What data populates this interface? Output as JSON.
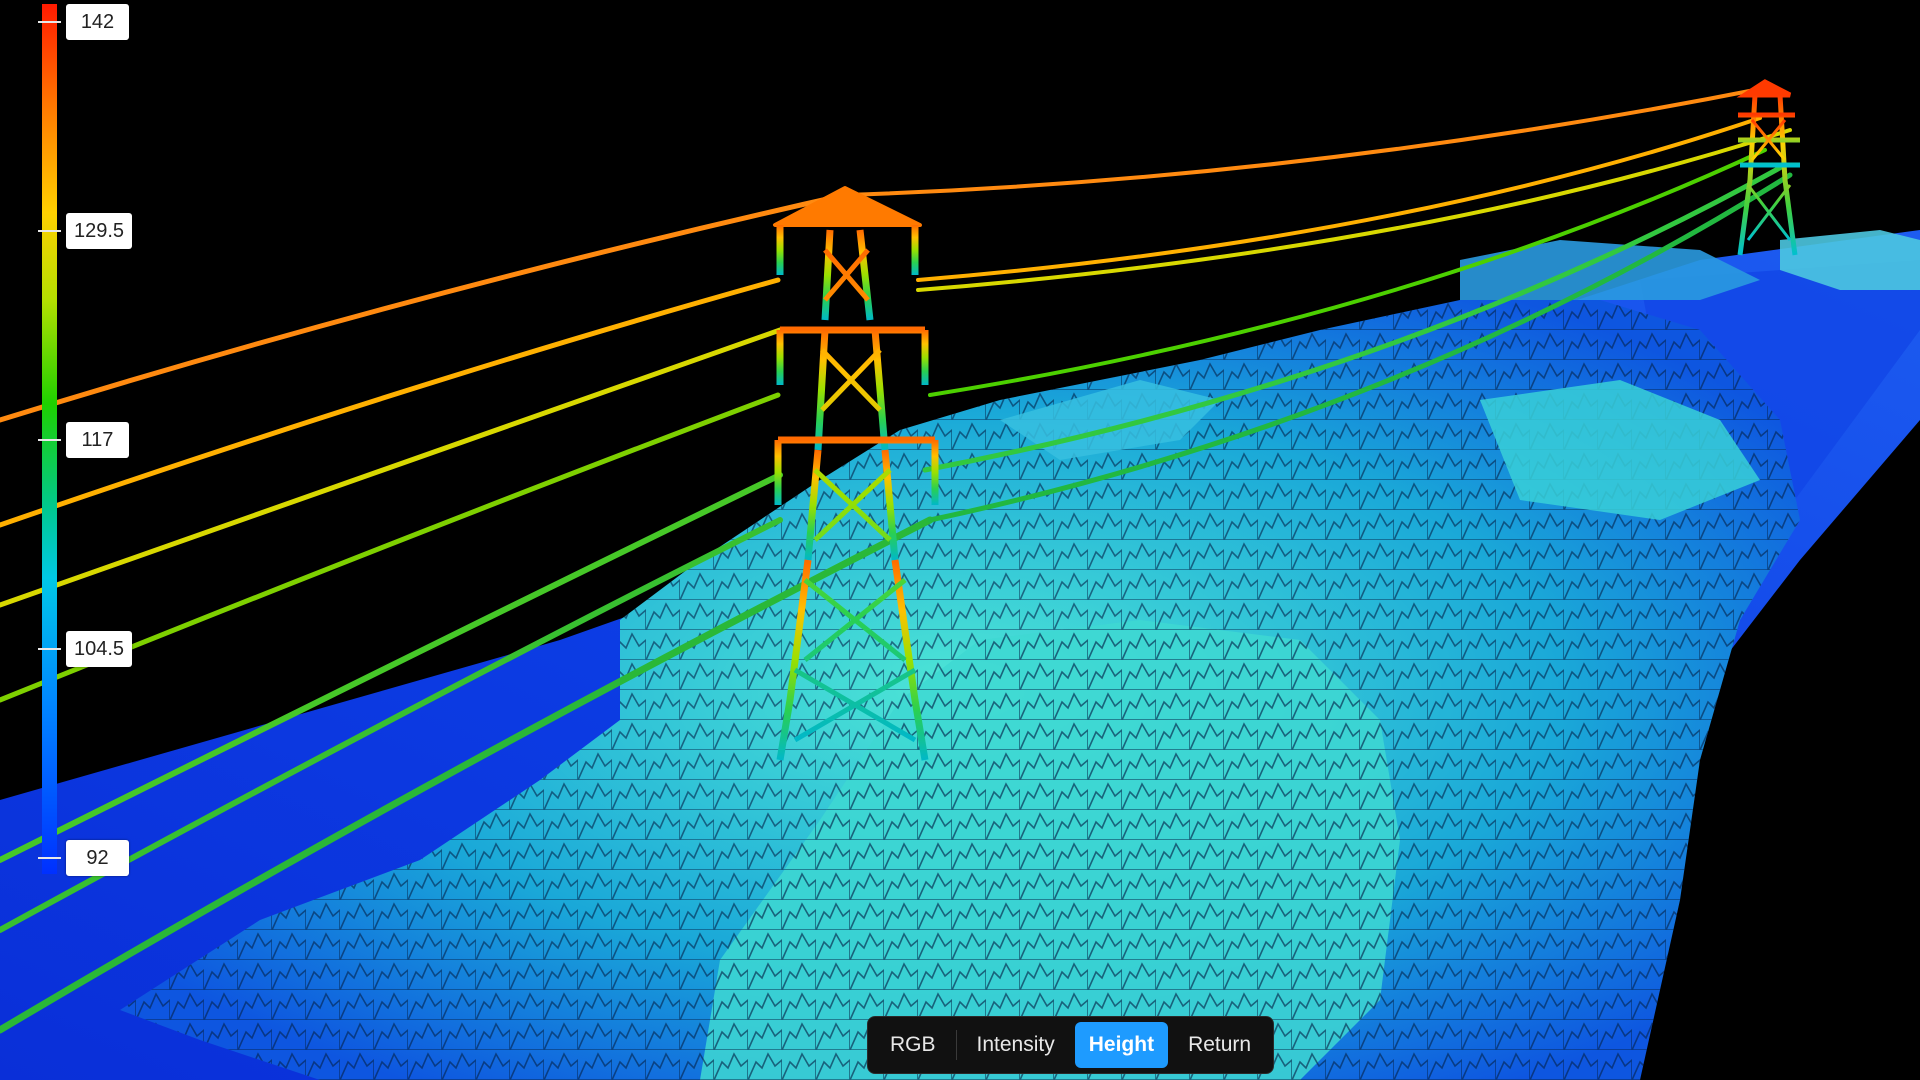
{
  "legend": {
    "max": 142,
    "min": 92,
    "ticks": [
      {
        "label": "142",
        "value": 142
      },
      {
        "label": "129.5",
        "value": 129.5
      },
      {
        "label": "117",
        "value": 117
      },
      {
        "label": "104.5",
        "value": 104.5
      },
      {
        "label": "92",
        "value": 92
      }
    ]
  },
  "view_modes": [
    {
      "label": "RGB",
      "active": false
    },
    {
      "label": "Intensity",
      "active": false
    },
    {
      "label": "Height",
      "active": true
    },
    {
      "label": "Return",
      "active": false
    }
  ],
  "colors": {
    "active_mode": "#1e9bff",
    "height_high": "#ff1a00",
    "height_mid": "#1ed000",
    "height_low": "#0030ff",
    "background": "#000000"
  }
}
